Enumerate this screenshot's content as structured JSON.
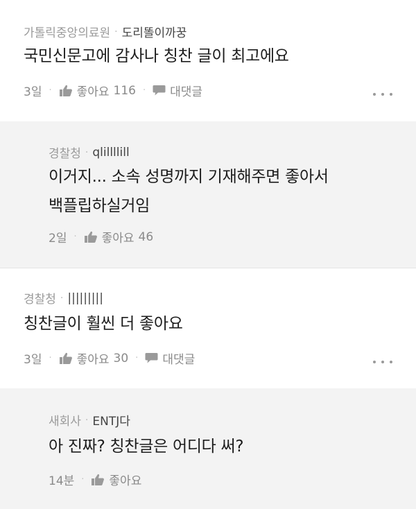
{
  "comments": [
    {
      "org": "가톨릭중앙의료원",
      "nick": "도리똘이까꿍",
      "text_lines": [
        "국민신문고에 감사나 칭찬 글이 최고에요"
      ],
      "time": "3일",
      "like_label": "좋아요",
      "like_count": "116",
      "reply_label": "대댓글"
    },
    {
      "org": "경찰청",
      "nick": "qlillllill",
      "text_lines": [
        "이거지... 소속 성명까지 기재해주면 좋아서",
        "백플립하실거임"
      ],
      "time": "2일",
      "like_label": "좋아요",
      "like_count": "46"
    },
    {
      "org": "경찰청",
      "nick": "|||||||||",
      "text_lines": [
        "칭찬글이 훨씬 더 좋아요"
      ],
      "time": "3일",
      "like_label": "좋아요",
      "like_count": "30",
      "reply_label": "대댓글"
    },
    {
      "org": "새회사",
      "nick": "ENTJ다",
      "text_lines": [
        "아 진짜? 칭찬글은 어디다 써?"
      ],
      "time": "14분",
      "like_label": "좋아요",
      "like_count": ""
    }
  ],
  "icons": {
    "like": "thumbs-up-icon",
    "reply": "speech-bubble-icon",
    "more": "more-dots-icon"
  }
}
